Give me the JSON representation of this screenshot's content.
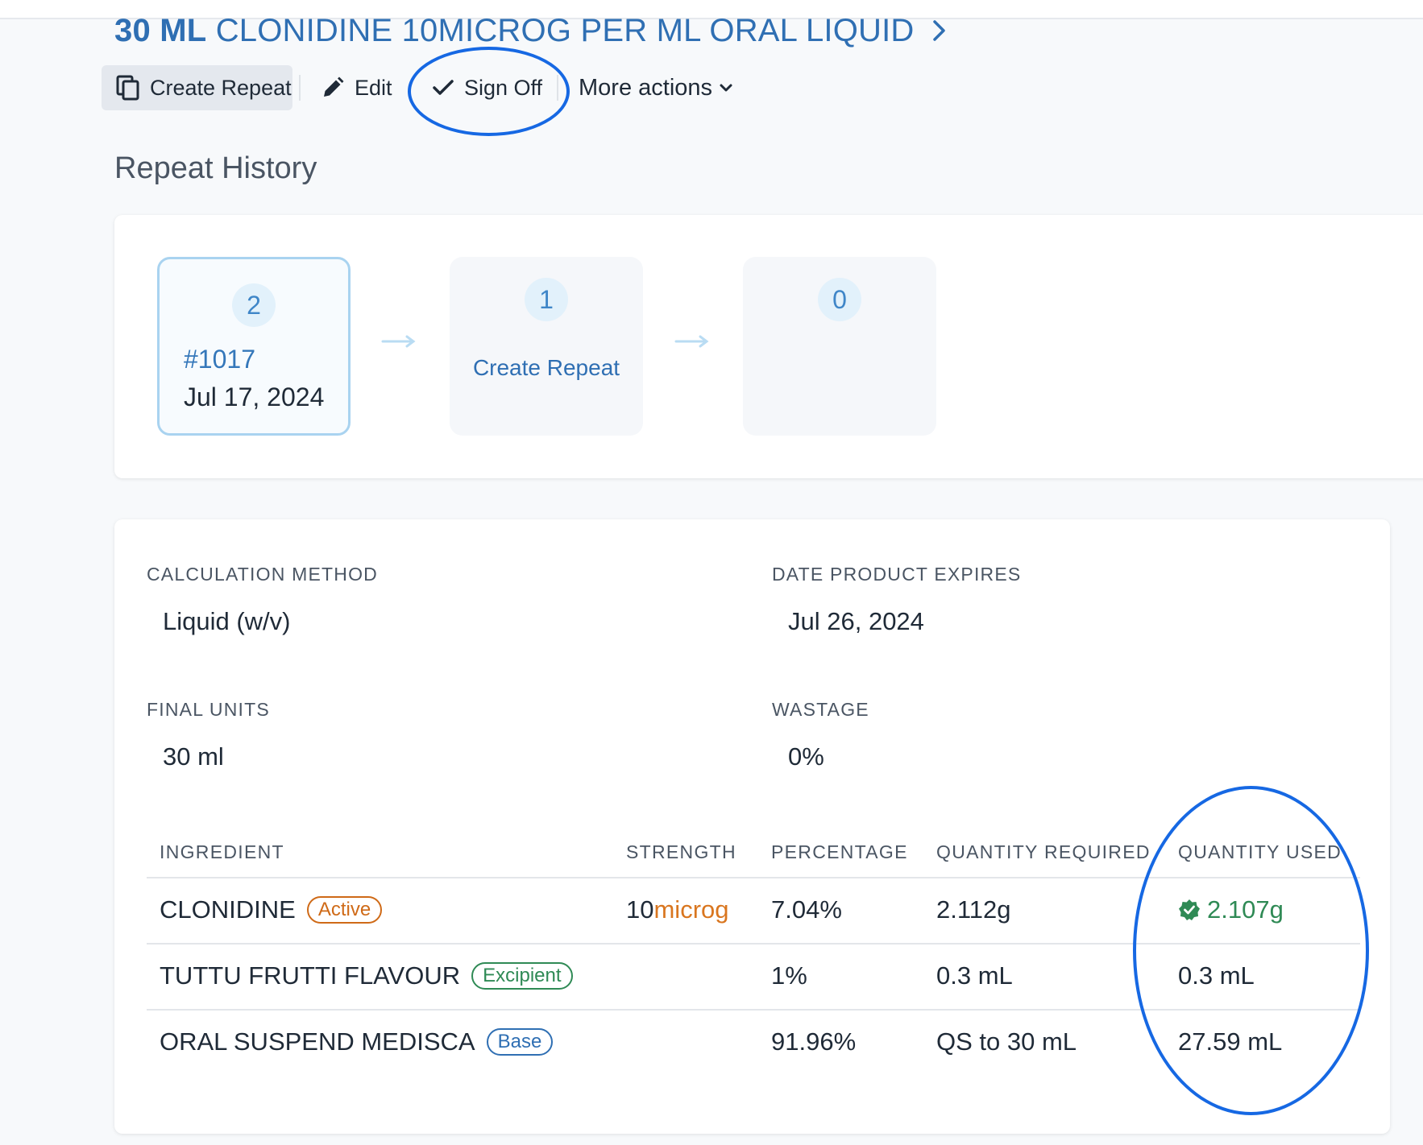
{
  "header": {
    "quantity": "30 ML",
    "product": "CLONIDINE 10MICROG PER ML ORAL LIQUID"
  },
  "toolbar": {
    "create_repeat": "Create Repeat",
    "edit": "Edit",
    "sign_off": "Sign Off",
    "more_actions": "More actions"
  },
  "repeat_history": {
    "title": "Repeat History",
    "steps": [
      {
        "number": "2",
        "id": "#1017",
        "date": "Jul 17, 2024"
      },
      {
        "number": "1",
        "action": "Create Repeat"
      },
      {
        "number": "0"
      }
    ]
  },
  "details": {
    "calculation_method_label": "CALCULATION METHOD",
    "calculation_method": "Liquid (w/v)",
    "date_expires_label": "DATE PRODUCT EXPIRES",
    "date_expires": "Jul 26, 2024",
    "final_units_label": "FINAL UNITS",
    "final_units": "30 ml",
    "wastage_label": "WASTAGE",
    "wastage": "0%"
  },
  "ingredients": {
    "columns": [
      "INGREDIENT",
      "STRENGTH",
      "PERCENTAGE",
      "QUANTITY REQUIRED",
      "QUANTITY USED"
    ],
    "rows": [
      {
        "name": "CLONIDINE",
        "tag": "Active",
        "strength_value": "10",
        "strength_unit": "microg",
        "percentage": "7.04%",
        "qty_required": "2.112g",
        "qty_used": "2.107g"
      },
      {
        "name": "TUTTU FRUTTI FLAVOUR",
        "tag": "Excipient",
        "percentage": "1%",
        "qty_required": "0.3 mL",
        "qty_used": "0.3 mL"
      },
      {
        "name": "ORAL SUSPEND MEDISCA",
        "tag": "Base",
        "percentage": "91.96%",
        "qty_required": "QS to 30 mL",
        "qty_used": "27.59 mL"
      }
    ]
  },
  "colors": {
    "link_blue": "#2f6fb3",
    "active_orange": "#cf6a17",
    "excipient_green": "#2f8a55",
    "annotation_blue": "#1668e3"
  },
  "icons": [
    "copy-icon",
    "pencil-icon",
    "checkmark-icon",
    "chevron-down-icon",
    "chevron-right-icon",
    "arrow-right-icon",
    "verified-badge-icon"
  ]
}
